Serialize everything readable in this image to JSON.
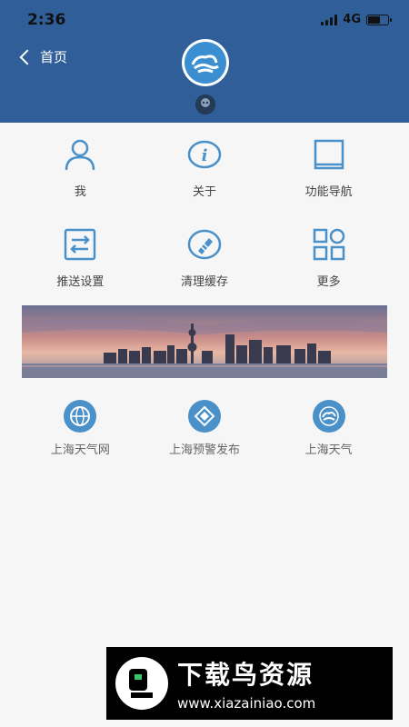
{
  "status_bar": {
    "time": "2:36",
    "network": "4G",
    "battery_level": 0.6
  },
  "header": {
    "back_label": "首页",
    "logo": "weather-cloud-logo",
    "avatar": "avatar-icon",
    "color": "#2f5e99"
  },
  "grid": {
    "rows": [
      [
        {
          "label": "我",
          "icon": "user-icon"
        },
        {
          "label": "关于",
          "icon": "info-icon"
        },
        {
          "label": "功能导航",
          "icon": "book-icon"
        }
      ],
      [
        {
          "label": "推送设置",
          "icon": "swap-icon"
        },
        {
          "label": "清理缓存",
          "icon": "broom-icon"
        },
        {
          "label": "更多",
          "icon": "grid-icon"
        }
      ]
    ]
  },
  "banner": {
    "subject": "Shanghai skyline at sunset"
  },
  "links": [
    {
      "label": "上海天气网",
      "icon": "globe-icon"
    },
    {
      "label": "上海预警发布",
      "icon": "diamond-icon"
    },
    {
      "label": "上海天气",
      "icon": "cloud-icon"
    }
  ],
  "watermark": {
    "title": "下载鸟资源",
    "url": "www.xiazainiao.com"
  },
  "colors": {
    "accent": "#4a90c9",
    "header_bg": "#2f5e99",
    "background": "#f6f6f6"
  }
}
